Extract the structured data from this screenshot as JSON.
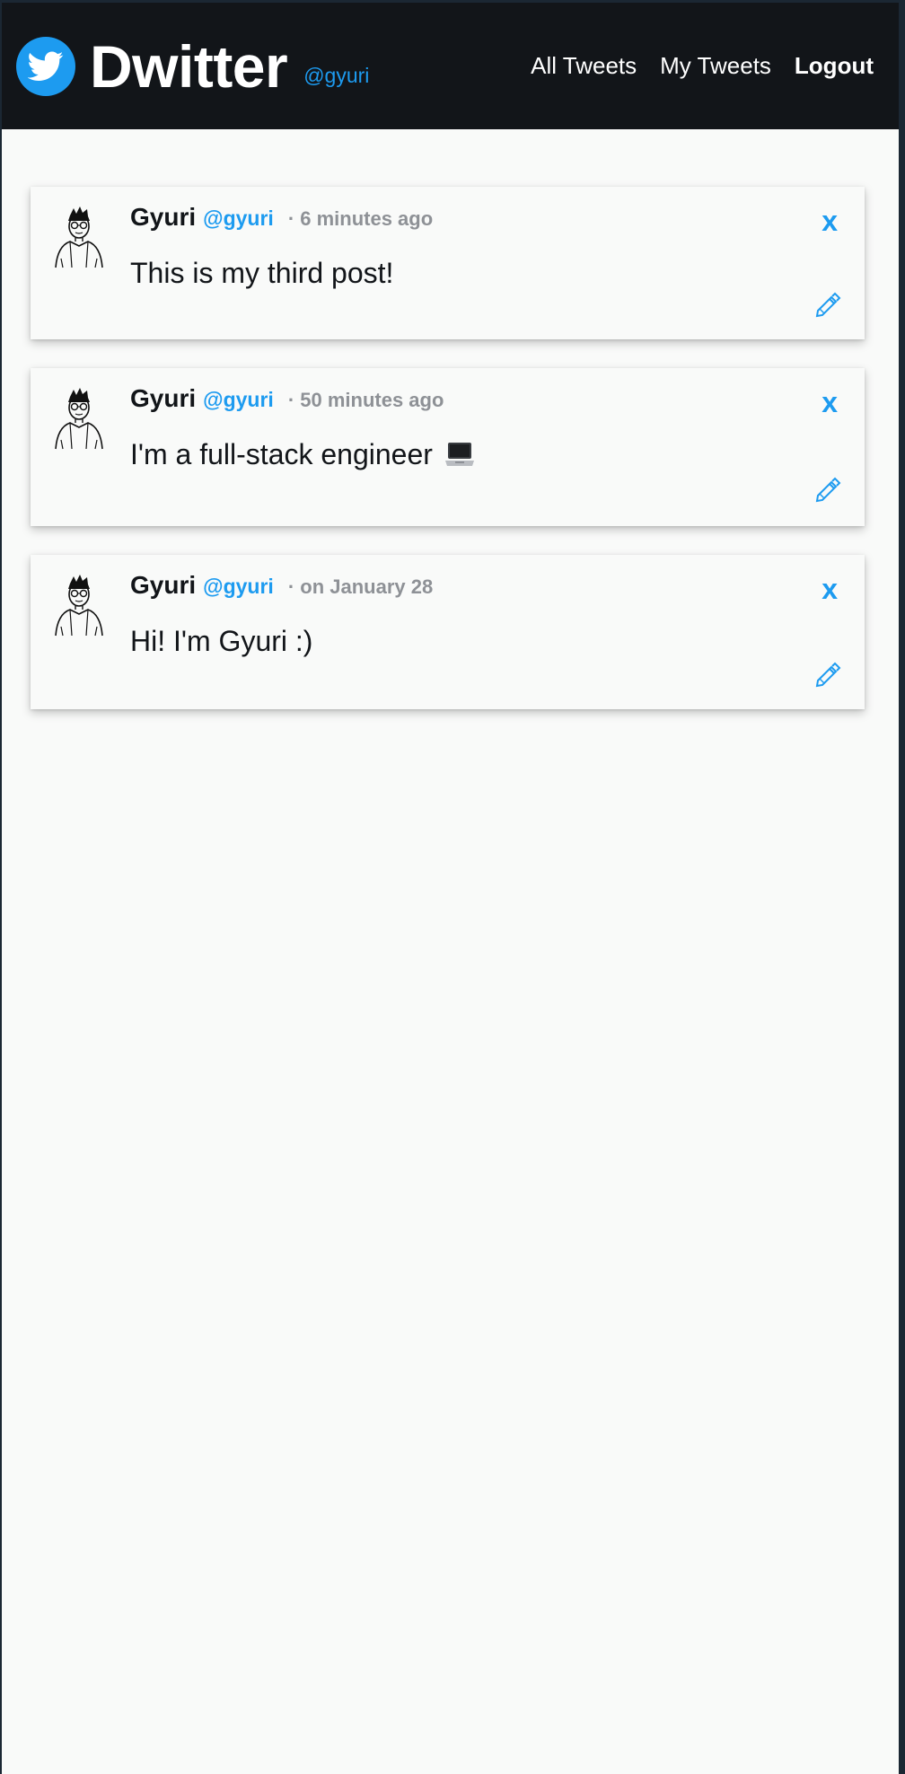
{
  "header": {
    "brand": "Dwitter",
    "handle": "@gyuri",
    "logo_icon": "twitter-bird-icon",
    "nav": {
      "all_tweets": "All Tweets",
      "my_tweets": "My Tweets",
      "logout": "Logout"
    }
  },
  "colors": {
    "accent": "#1d9bf0",
    "header_bg": "#121519",
    "page_bg": "#f9faf9",
    "muted": "#8e9196"
  },
  "tweets": [
    {
      "name": "Gyuri",
      "handle": "@gyuri",
      "time": "· 6 minutes ago",
      "text": "This is my third post!",
      "delete_label": "x",
      "edit_icon": "pencil-icon"
    },
    {
      "name": "Gyuri",
      "handle": "@gyuri",
      "time": "· 50 minutes ago",
      "text": "I'm a full-stack engineer",
      "text_icon": "laptop-icon",
      "delete_label": "x",
      "edit_icon": "pencil-icon"
    },
    {
      "name": "Gyuri",
      "handle": "@gyuri",
      "time": "· on January 28",
      "text": "Hi! I'm Gyuri :)",
      "delete_label": "x",
      "edit_icon": "pencil-icon"
    }
  ]
}
